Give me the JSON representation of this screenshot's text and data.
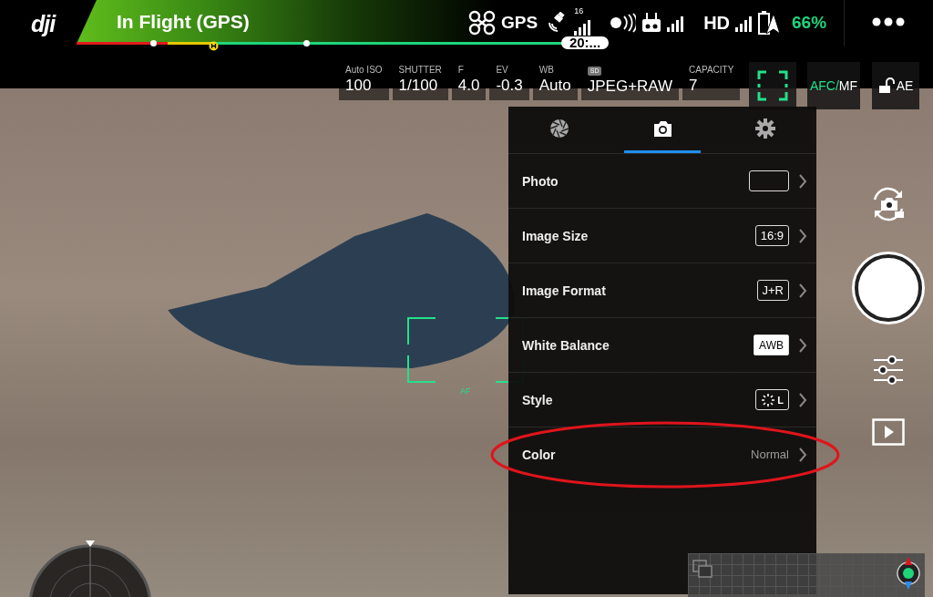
{
  "status_bar": {
    "brand": "dji",
    "title": "In Flight (GPS)",
    "gps_label": "GPS",
    "satellite_count": "16",
    "hd_label": "HD",
    "battery": "66%",
    "flight_time": "20:..."
  },
  "camera_params": [
    {
      "label": "Auto ISO",
      "value": "100"
    },
    {
      "label": "SHUTTER",
      "value": "1/100"
    },
    {
      "label": "F",
      "value": "4.0"
    },
    {
      "label": "EV",
      "value": "-0.3"
    },
    {
      "label": "WB",
      "value": "Auto"
    },
    {
      "label": "SD",
      "value": "JPEG+RAW"
    },
    {
      "label": "CAPACITY",
      "value": "7"
    }
  ],
  "focus_mode": {
    "auto": "AFC/",
    "manual": "MF"
  },
  "ae_lock": {
    "label": "AE",
    "locked": false
  },
  "viewfinder": {
    "af_label": "AF"
  },
  "settings_panel": {
    "tabs": [
      {
        "kind": "aperture",
        "selected": false
      },
      {
        "kind": "camera",
        "selected": true
      },
      {
        "kind": "gear",
        "selected": false
      }
    ],
    "rows": [
      {
        "label": "Photo",
        "kind": "blank",
        "circled": false
      },
      {
        "label": "Image Size",
        "kind": "boxed",
        "value": "16:9",
        "circled": false
      },
      {
        "label": "Image Format",
        "kind": "boxed",
        "value": "J+R",
        "circled": false
      },
      {
        "label": "White Balance",
        "kind": "filled",
        "value": "AWB",
        "circled": false
      },
      {
        "label": "Style",
        "kind": "style",
        "value": "L",
        "circled": false
      },
      {
        "label": "Color",
        "kind": "text",
        "value": "Normal",
        "circled": true
      }
    ]
  }
}
